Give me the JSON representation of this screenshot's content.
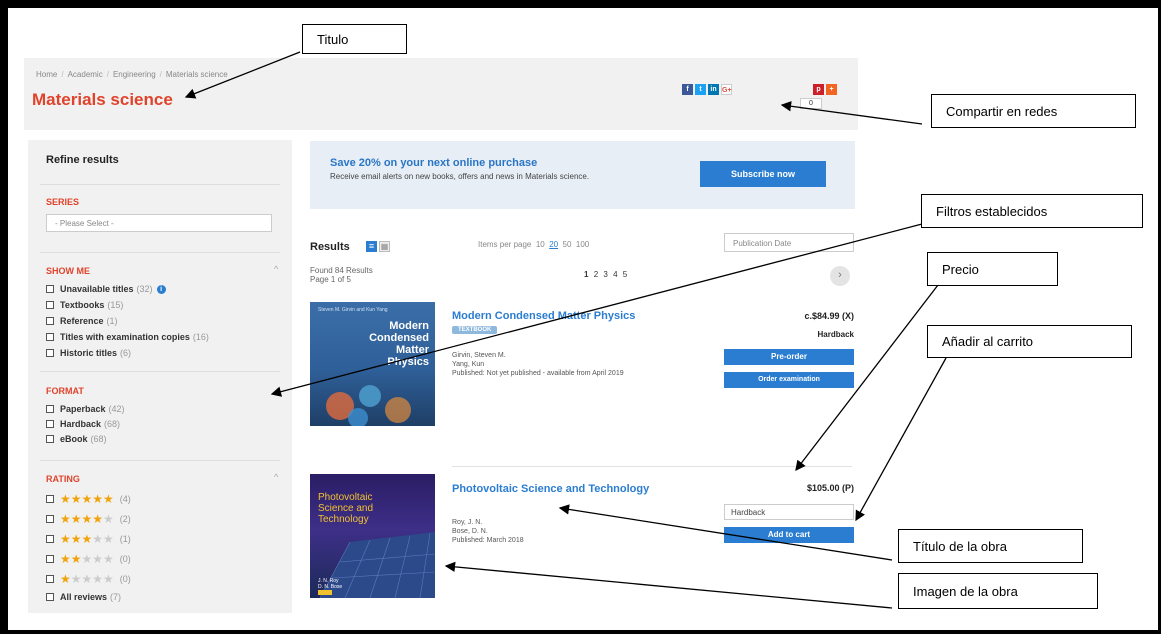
{
  "breadcrumb": [
    "Home",
    "Academic",
    "Engineering",
    "Materials science"
  ],
  "page_title": "Materials science",
  "share": {
    "count": "0"
  },
  "sidebar": {
    "heading": "Refine results",
    "series": {
      "label": "SERIES",
      "select_value": "- Please Select -"
    },
    "show_me": {
      "label": "SHOW ME",
      "items": [
        {
          "label": "Unavailable titles",
          "count": "(32)"
        },
        {
          "label": "Textbooks",
          "count": "(15)"
        },
        {
          "label": "Reference",
          "count": "(1)"
        },
        {
          "label": "Titles with examination copies",
          "count": "(16)"
        },
        {
          "label": "Historic titles",
          "count": "(6)"
        }
      ]
    },
    "format": {
      "label": "FORMAT",
      "items": [
        {
          "label": "Paperback",
          "count": "(42)"
        },
        {
          "label": "Hardback",
          "count": "(68)"
        },
        {
          "label": "eBook",
          "count": "(68)"
        }
      ]
    },
    "rating": {
      "label": "RATING",
      "items": [
        {
          "stars": 5,
          "count": "(4)"
        },
        {
          "stars": 4,
          "count": "(2)"
        },
        {
          "stars": 3,
          "count": "(1)"
        },
        {
          "stars": 2,
          "count": "(0)"
        },
        {
          "stars": 1,
          "count": "(0)"
        }
      ],
      "all_label": "All reviews",
      "all_count": "(7)"
    }
  },
  "promo": {
    "headline": "Save 20% on your next online purchase",
    "text": "Receive email alerts on new books, offers and news in Materials science.",
    "button": "Subscribe now"
  },
  "results": {
    "heading": "Results",
    "items_per_page_label": "Items per page",
    "items_per_page": [
      "10",
      "20",
      "50",
      "100"
    ],
    "items_per_page_selected": "20",
    "sort_value": "Publication Date",
    "found": "Found 84 Results",
    "page_of": "Page 1 of 5",
    "pages": [
      "1",
      "2",
      "3",
      "4",
      "5"
    ],
    "books": [
      {
        "title": "Modern Condensed Matter Physics",
        "tag": "TEXTBOOK",
        "authors": [
          "Girvin, Steven M.",
          "Yang, Kun"
        ],
        "published": "Published: Not yet published - available from April 2019",
        "price": "c.$84.99 (X)",
        "format": "Hardback",
        "primary_button": "Pre-order",
        "secondary_button": "Order examination",
        "cover_lines": [
          "Modern",
          "Condensed",
          "Matter",
          "Physics"
        ],
        "cover_authors": "Steven M. Girvin and Kun Yang"
      },
      {
        "title": "Photovoltaic Science and Technology",
        "authors": [
          "Roy, J. N.",
          "Bose, D. N."
        ],
        "published": "Published: March 2018",
        "price": "$105.00 (P)",
        "format_select": "Hardback",
        "primary_button": "Add to cart",
        "cover_lines": [
          "Photovoltaic",
          "Science and",
          "Technology"
        ],
        "cover_authors": [
          "J. N. Roy",
          "D. N. Bose"
        ]
      }
    ]
  },
  "annotations": {
    "titulo": "Titulo",
    "compartir": "Compartir en redes",
    "filtros": "Filtros establecidos",
    "precio": "Precio",
    "anadir": "Añadir al carrito",
    "titulo_obra": "Título de la obra",
    "imagen_obra": "Imagen de la obra"
  }
}
